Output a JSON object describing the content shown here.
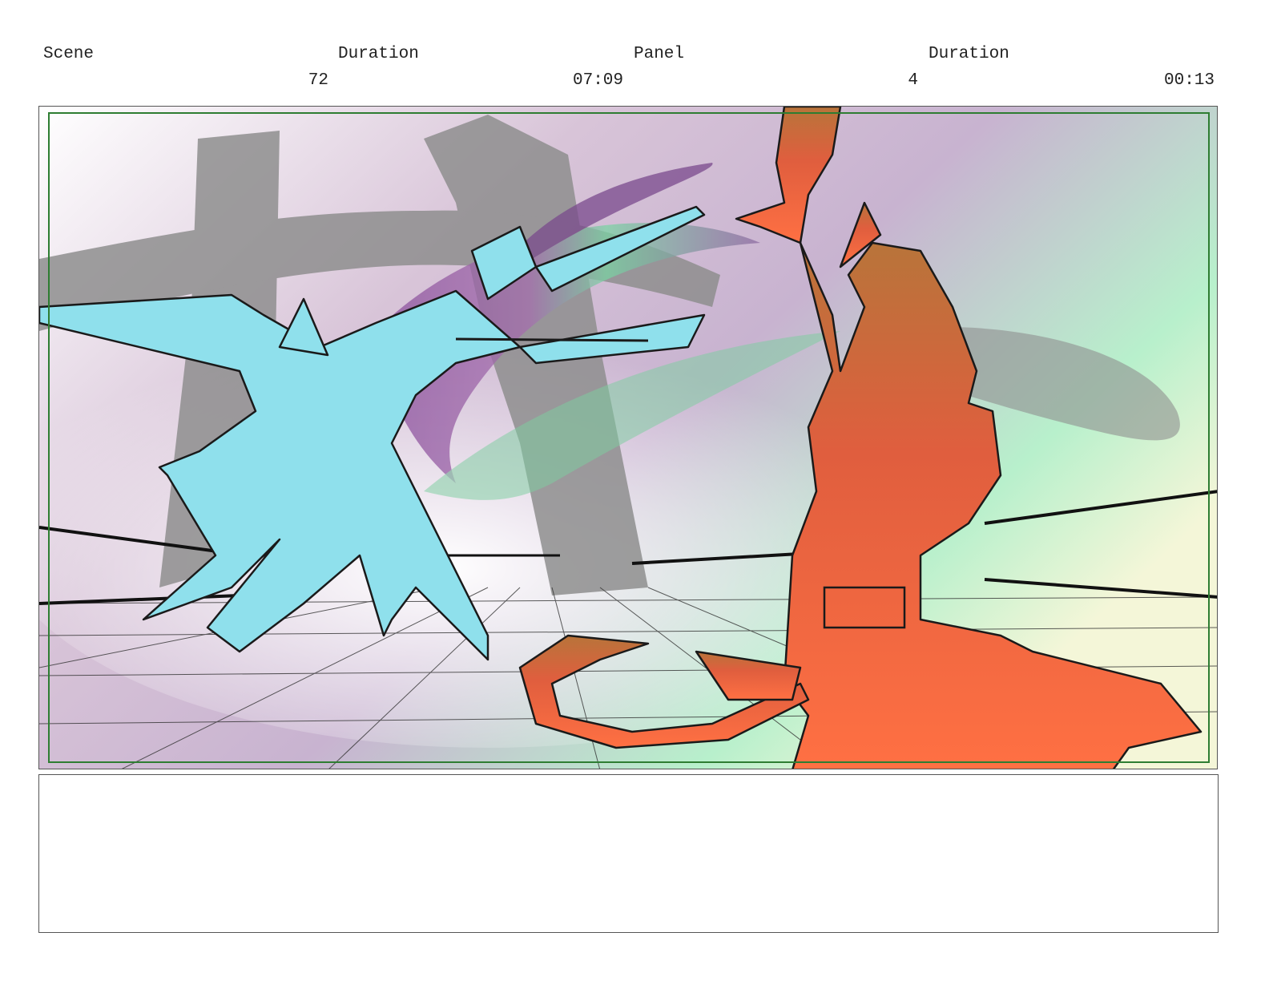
{
  "header": {
    "scene_label": "Scene",
    "scene_duration_label": "Duration",
    "panel_label": "Panel",
    "panel_duration_label": "Duration",
    "scene_value": "72",
    "scene_duration_value": "07:09",
    "panel_value": "4",
    "panel_duration_value": "00:13"
  },
  "notes": {
    "text": ""
  },
  "colors": {
    "safe_area_border": "#2e7d32",
    "cyan_character": "#8fe0ec",
    "red_character": "#f06a3c",
    "background_gradient_top": "#a7f0c8",
    "background_gradient_mid": "#c9a6c9"
  }
}
